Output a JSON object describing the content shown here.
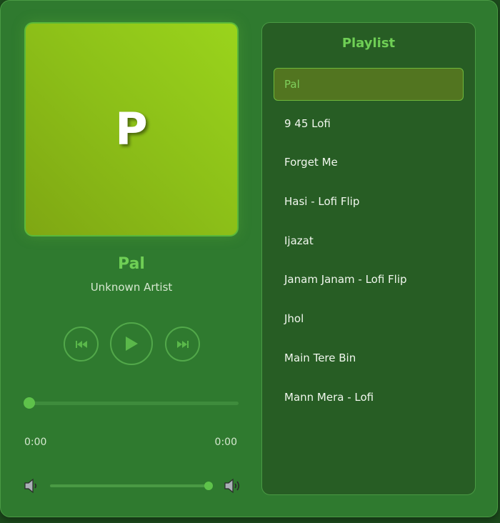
{
  "now_playing": {
    "art_letter": "P",
    "title": "Pal",
    "artist": "Unknown Artist",
    "progress": 0,
    "current_time": "0:00",
    "duration": "0:00",
    "volume": 1.0
  },
  "controls": {
    "prev_icon": "skip-previous-icon",
    "play_icon": "play-icon",
    "next_icon": "skip-next-icon",
    "volume_low_icon": "speaker-low-icon",
    "volume_high_icon": "speaker-high-icon"
  },
  "playlist": {
    "title": "Playlist",
    "active_index": 0,
    "items": [
      {
        "label": "Pal"
      },
      {
        "label": "9 45 Lofi"
      },
      {
        "label": "Forget Me"
      },
      {
        "label": "Hasi - Lofi Flip"
      },
      {
        "label": "Ijazat"
      },
      {
        "label": "Janam Janam - Lofi Flip"
      },
      {
        "label": "Jhol"
      },
      {
        "label": "Main Tere Bin"
      },
      {
        "label": "Mann Mera - Lofi"
      }
    ]
  },
  "colors": {
    "accent": "#5ec24a",
    "panel": "#2f7a2f",
    "playlist_bg": "#275d24",
    "active_item": "#527520"
  }
}
